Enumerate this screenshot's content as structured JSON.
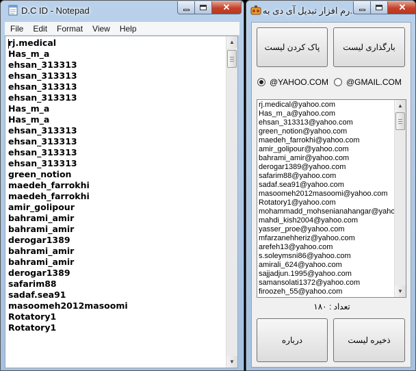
{
  "notepad": {
    "title": "D.C ID - Notepad",
    "menu": [
      "File",
      "Edit",
      "Format",
      "View",
      "Help"
    ],
    "lines": [
      "rj.medical",
      "Has_m_a",
      "ehsan_313313",
      "ehsan_313313",
      "ehsan_313313",
      "ehsan_313313",
      "Has_m_a",
      "Has_m_a",
      "ehsan_313313",
      "ehsan_313313",
      "ehsan_313313",
      "ehsan_313313",
      "green_notion",
      "maedeh_farrokhi",
      "maedeh_farrokhi",
      "amir_golipour",
      "bahrami_amir",
      "bahrami_amir",
      "derogar1389",
      "bahrami_amir",
      "bahrami_amir",
      "derogar1389",
      "safarim88",
      "sadaf.sea91",
      "masoomeh2012masoomi",
      "Rotatory1",
      "Rotatory1"
    ]
  },
  "app": {
    "title": "...رم افزار تبدیل آی دی به",
    "load_list_label": "بارگذاری لیست",
    "clear_list_label": "پاک کردن لیست",
    "yahoo_option": "@YAHOO.COM",
    "gmail_option": "@GMAIL.COM",
    "selected_domain": "@YAHOO.COM",
    "emails": [
      "rj.medical@yahoo.com",
      "Has_m_a@yahoo.com",
      "ehsan_313313@yahoo.com",
      "green_notion@yahoo.com",
      "maedeh_farrokhi@yahoo.com",
      "amir_golipour@yahoo.com",
      "bahrami_amir@yahoo.com",
      "derogar1389@yahoo.com",
      "safarim88@yahoo.com",
      "sadaf.sea91@yahoo.com",
      "masoomeh2012masoomi@yahoo.com",
      "Rotatory1@yahoo.com",
      "mohammadd_mohsenianahangar@yahoo.com",
      "mahdi_kish2004@yahoo.com",
      "yasser_proe@yahoo.com",
      "mfarzanehheriz@yahoo.com",
      "arefeh13@yahoo.com",
      "s.soleymsni86@yahoo.com",
      "amirali_624@yahoo.com",
      "sajjadjun.1995@yahoo.com",
      "samansolati1372@yahoo.com",
      "firoozeh_55@yahoo.com"
    ],
    "count_label": "تعداد : ۱۸۰",
    "save_list_label": "ذخیره لیست",
    "about_label": "درباره"
  },
  "colors": {
    "title_bar": "#b9d1ea",
    "close_button": "#c5412a",
    "client_bg": "#f0f0f0"
  }
}
